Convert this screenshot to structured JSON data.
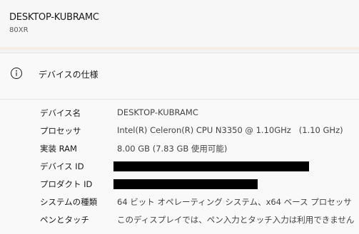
{
  "header": {
    "device_name": "DESKTOP-KUBRAMC",
    "model": "80XR"
  },
  "device_specs": {
    "title": "デバイスの仕様",
    "icon": "info-icon",
    "rows": [
      {
        "label": "デバイス名",
        "value": "DESKTOP-KUBRAMC",
        "redacted": false
      },
      {
        "label": "プロセッサ",
        "value": "Intel(R) Celeron(R) CPU N3350 @ 1.10GHz   (1.10 GHz)",
        "redacted": false
      },
      {
        "label": "実装 RAM",
        "value": "8.00 GB (7.83 GB 使用可能)",
        "redacted": false
      },
      {
        "label": "デバイス ID",
        "value": "",
        "redacted": true
      },
      {
        "label": "プロダクト ID",
        "value": "",
        "redacted": true
      },
      {
        "label": "システムの種類",
        "value": "64 ビット オペレーティング システム、x64 ベース プロセッサ",
        "redacted": false
      },
      {
        "label": "ペンとタッチ",
        "value": "このディスプレイでは、ペン入力とタッチ入力は利用できません",
        "redacted": false
      }
    ]
  }
}
